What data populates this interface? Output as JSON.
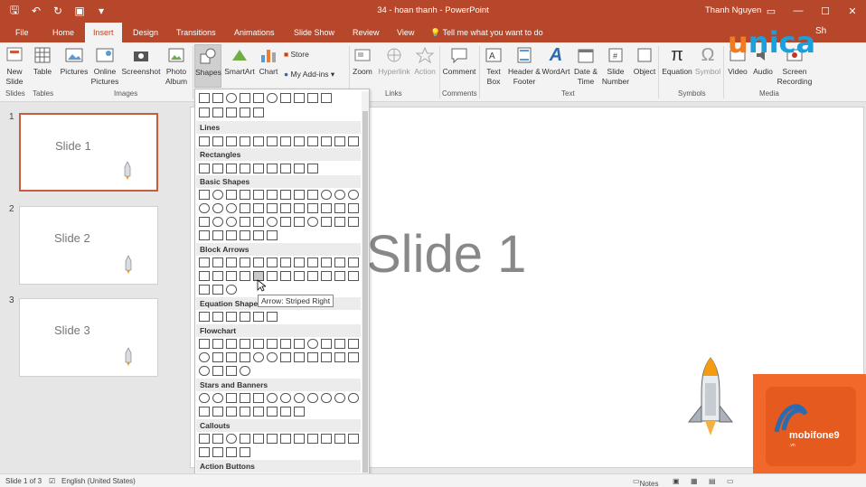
{
  "titlebar": {
    "title": "34 - hoan thanh  -  PowerPoint",
    "user": "Thanh Nguyen"
  },
  "tabs": [
    "File",
    "Home",
    "Insert",
    "Design",
    "Transitions",
    "Animations",
    "Slide Show",
    "Review",
    "View"
  ],
  "active_tab": "Insert",
  "tell_me": "Tell me what you want to do",
  "share_label": "Sh",
  "ribbon": {
    "new_slide": "New Slide",
    "table": "Table",
    "pictures": "Pictures",
    "online_pictures": "Online Pictures",
    "screenshot": "Screenshot",
    "photo_album": "Photo Album",
    "shapes": "Shapes",
    "smartart": "SmartArt",
    "chart": "Chart",
    "store": "Store",
    "my_addins": "My Add-ins",
    "zoom": "Zoom",
    "hyperlink": "Hyperlink",
    "action": "Action",
    "comment": "Comment",
    "text_box": "Text Box",
    "header_footer": "Header & Footer",
    "wordart": "WordArt",
    "date_time": "Date & Time",
    "slide_number": "Slide Number",
    "object": "Object",
    "equation": "Equation",
    "symbol": "Symbol",
    "video": "Video",
    "audio": "Audio",
    "screen_recording": "Screen Recording",
    "groups": {
      "slides": "Slides",
      "tables": "Tables",
      "images": "Images",
      "links": "Links",
      "comments": "Comments",
      "text": "Text",
      "symbols": "Symbols",
      "media": "Media"
    }
  },
  "logo": {
    "u": "u",
    "rest": "nica"
  },
  "thumbnails": [
    {
      "num": "1",
      "label": "Slide 1"
    },
    {
      "num": "2",
      "label": "Slide 2"
    },
    {
      "num": "3",
      "label": "Slide 3"
    }
  ],
  "slide_title": "Slide 1",
  "gallery": {
    "sections": [
      "Lines",
      "Rectangles",
      "Basic Shapes",
      "Block Arrows",
      "Equation Shapes",
      "Flowchart",
      "Stars and Banners",
      "Callouts",
      "Action Buttons"
    ],
    "tooltip": "Arrow: Striped Right"
  },
  "status": {
    "slide_info": "Slide 1 of 3",
    "language": "English (United States)",
    "notes": "Notes"
  },
  "badge": {
    "brand": "mobifone9",
    "sub": ".vn"
  }
}
